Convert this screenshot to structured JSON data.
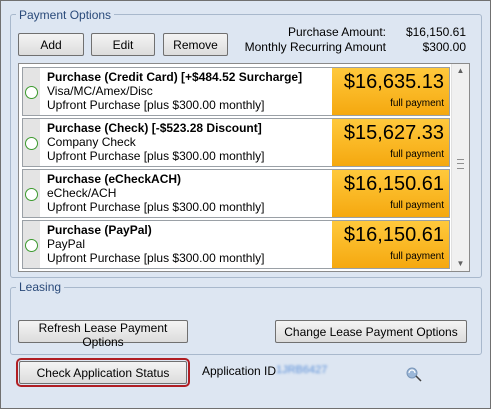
{
  "payment_options": {
    "title": "Payment Options",
    "buttons": {
      "add": "Add",
      "edit": "Edit",
      "remove": "Remove"
    },
    "summary": {
      "purchase_amount_label": "Purchase Amount:",
      "purchase_amount_value": "$16,150.61",
      "monthly_recurring_label": "Monthly Recurring Amount",
      "monthly_recurring_value": "$300.00"
    },
    "options": [
      {
        "title": "Purchase (Credit Card) [+$484.52 Surcharge]",
        "method": "Visa/MC/Amex/Disc",
        "detail": "Upfront Purchase [plus $300.00 monthly]",
        "price": "$16,635.13",
        "term": "full payment"
      },
      {
        "title": "Purchase (Check) [-$523.28 Discount]",
        "method": "Company Check",
        "detail": "Upfront Purchase [plus $300.00 monthly]",
        "price": "$15,627.33",
        "term": "full payment"
      },
      {
        "title": "Purchase (eCheckACH)",
        "method": "eCheck/ACH",
        "detail": "Upfront Purchase [plus $300.00 monthly]",
        "price": "$16,150.61",
        "term": "full payment"
      },
      {
        "title": "Purchase (PayPal)",
        "method": "PayPal",
        "detail": "Upfront Purchase [plus $300.00 monthly]",
        "price": "$16,150.61",
        "term": "full payment"
      }
    ]
  },
  "leasing": {
    "title": "Leasing",
    "refresh_button": "Refresh Lease Payment Options",
    "change_button": "Change Lease Payment Options"
  },
  "footer": {
    "check_status_button": "Check Application Status",
    "application_id_label": "Application ID",
    "application_id_value": "1JRB6427"
  },
  "colors": {
    "highlight_border": "#b01e23",
    "price_box": "#f5a80f",
    "radio_border": "#3c9a2e"
  },
  "icons": {
    "scroll_up": "scroll-up-arrow-icon",
    "scroll_down": "scroll-down-arrow-icon",
    "cursor": "busy-cursor-icon"
  }
}
